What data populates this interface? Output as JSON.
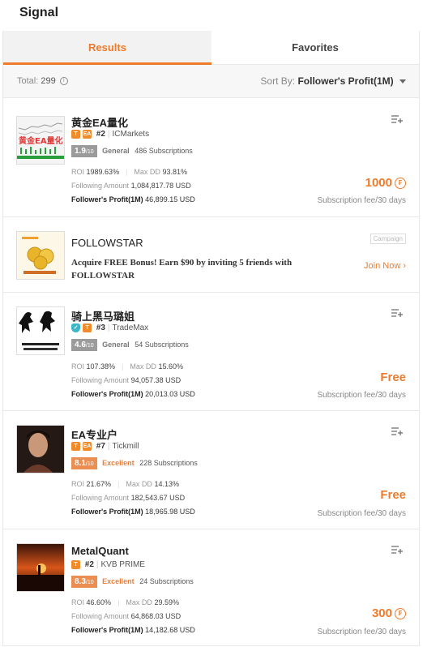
{
  "header": {
    "title": "Signal"
  },
  "tabs": [
    {
      "label": "Results",
      "active": true
    },
    {
      "label": "Favorites",
      "active": false
    }
  ],
  "toolbar": {
    "total_label": "Total:",
    "total_value": "299",
    "sort_label": "Sort By:",
    "sort_value": "Follower's Profit(1M)"
  },
  "colors": {
    "accent": "#ee7b2b",
    "score_general": "#9b9b9b",
    "score_excellent": "#ec8e51"
  },
  "cards": [
    {
      "name": "黄金EA量化",
      "badges": [
        "T",
        "EA"
      ],
      "rank": "#2",
      "broker": "ICMarkets",
      "score": "1.9",
      "score_max": "/10",
      "level": "General",
      "subscriptions": "486 Subscriptions",
      "roi_label": "ROI",
      "roi": "1989.63%",
      "dd_label": "Max DD",
      "dd": "93.81%",
      "follow_label": "Following Amount",
      "follow": "1,084,817.78 USD",
      "profit_label": "Follower's Profit(1M)",
      "profit": "46,899.15 USD",
      "price": "1000",
      "fee": "Subscription fee/30 days",
      "avatar_text": "黄金EA量化"
    },
    {
      "name": "骑上黑马璐姐",
      "badges": [
        "shield",
        "T"
      ],
      "rank": "#3",
      "broker": "TradeMax",
      "score": "4.6",
      "score_max": "/10",
      "level": "General",
      "subscriptions": "54 Subscriptions",
      "roi_label": "ROI",
      "roi": "107.38%",
      "dd_label": "Max DD",
      "dd": "15.60%",
      "follow_label": "Following Amount",
      "follow": "94,057.38 USD",
      "profit_label": "Follower's Profit(1M)",
      "profit": "20,013.03 USD",
      "price": "Free",
      "fee": "Subscription fee/30 days"
    },
    {
      "name": "EA专业户",
      "badges": [
        "T",
        "EA"
      ],
      "rank": "#7",
      "broker": "Tickmill",
      "score": "8.1",
      "score_max": "/10",
      "level": "Excellent",
      "subscriptions": "228 Subscriptions",
      "roi_label": "ROI",
      "roi": "21.67%",
      "dd_label": "Max DD",
      "dd": "14.13%",
      "follow_label": "Following Amount",
      "follow": "182,543.67 USD",
      "profit_label": "Follower's Profit(1M)",
      "profit": "18,965.98 USD",
      "price": "Free",
      "fee": "Subscription fee/30 days"
    },
    {
      "name": "MetalQuant",
      "badges": [
        "T"
      ],
      "rank": "#2",
      "broker": "KVB PRIME",
      "score": "8.3",
      "score_max": "/10",
      "level": "Excellent",
      "subscriptions": "24 Subscriptions",
      "roi_label": "ROI",
      "roi": "46.60%",
      "dd_label": "Max DD",
      "dd": "29.59%",
      "follow_label": "Following Amount",
      "follow": "64,868.03 USD",
      "profit_label": "Follower's Profit(1M)",
      "profit": "14,182.68 USD",
      "price": "300",
      "fee": "Subscription fee/30 days"
    }
  ],
  "campaign": {
    "name": "FOLLOWSTAR",
    "tag": "Campaign",
    "description": "Acquire FREE Bonus!  Earn $90 by inviting 5 friends with FOLLOWSTAR",
    "join": "Join Now"
  }
}
